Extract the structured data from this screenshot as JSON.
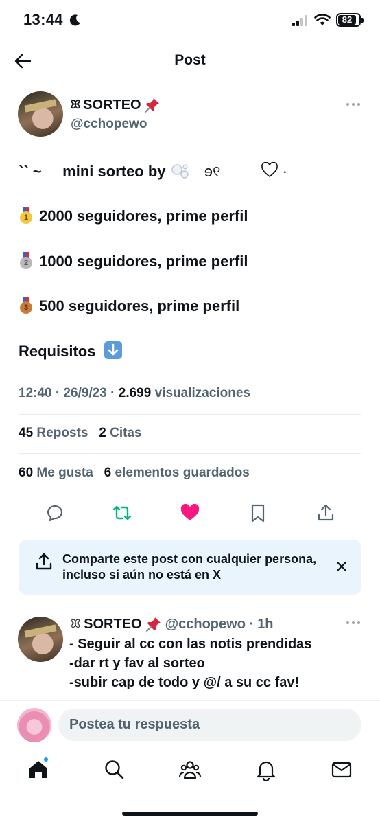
{
  "status_bar": {
    "time": "13:44",
    "battery": "82"
  },
  "header": {
    "title": "Post"
  },
  "post": {
    "author_name": "SORTEO",
    "author_handle": "@cchopewo",
    "lines": {
      "title": "`` ~     mini sorteo by",
      "title_tail": "ɘ୧",
      "prize1": "2000 seguidores, prime perfil",
      "prize2": "1000 seguidores, prime perfil",
      "prize3": "500 seguidores, prime perfil",
      "requirements": "Requisitos"
    },
    "timestamp": "12:40 · 26/9/23 · ",
    "views_count": "2.699",
    "views_label": "visualizaciones",
    "reposts_count": "45",
    "reposts_label": "Reposts",
    "quotes_count": "2",
    "quotes_label": "Citas",
    "likes_count": "60",
    "likes_label": "Me gusta",
    "bookmarks_count": "6",
    "bookmarks_label": "elementos guardados",
    "liked": true
  },
  "share_prompt": {
    "text": "Comparte este post con cualquier persona, incluso si aún no está en X"
  },
  "reply": {
    "author_name": "SORTEO",
    "author_handle": "@cchopewo",
    "time": "· 1h",
    "lines": [
      "- Seguir al cc con las notis prendidas",
      "-dar rt y fav al sorteo",
      "-subir cap de todo y @/ a su cc fav!"
    ]
  },
  "compose": {
    "placeholder": "Postea tu respuesta"
  },
  "colors": {
    "accent": "#1d9bf0",
    "like": "#f91880",
    "repost": "#00ba7c",
    "secondary_text": "#536471"
  }
}
